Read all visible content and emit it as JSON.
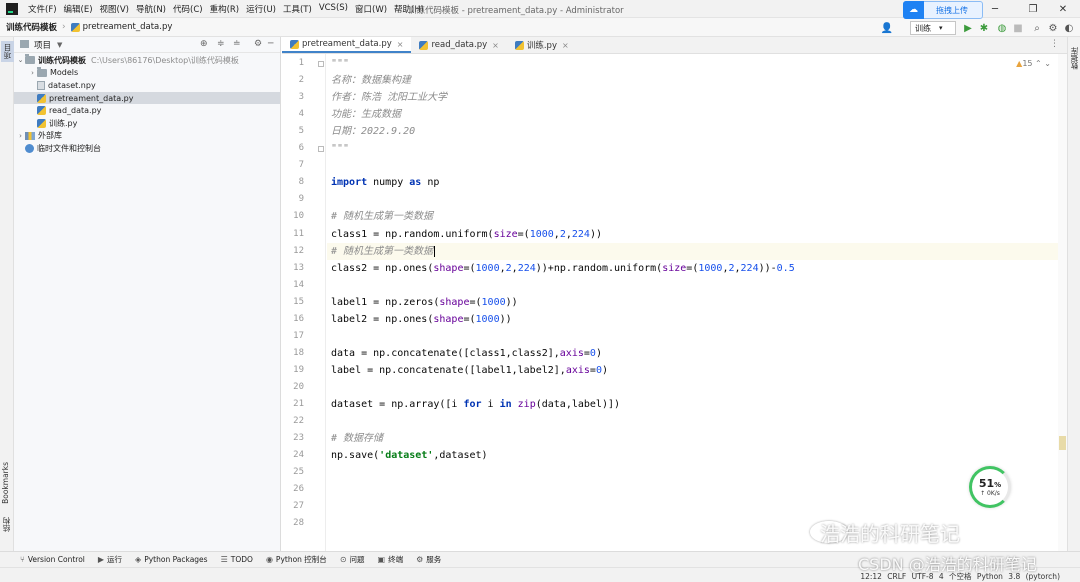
{
  "window": {
    "title": "训练代码模板 - pretreament_data.py - Administrator",
    "controls": {
      "minimize": "─",
      "restore": "❐",
      "close": "✕"
    }
  },
  "menu": [
    "文件(F)",
    "编辑(E)",
    "视图(V)",
    "导航(N)",
    "代码(C)",
    "重构(R)",
    "运行(U)",
    "工具(T)",
    "VCS(S)",
    "窗口(W)",
    "帮助(H)"
  ],
  "nav": {
    "project": "训练代码模板",
    "separator": "›",
    "file": "pretreament_data.py",
    "upload_button": "拖拽上传",
    "run_config": "训练"
  },
  "left_strip": {
    "project_tab": "项目",
    "bookmarks_tab": "Bookmarks",
    "structure_tab": "结构"
  },
  "right_strip": {
    "db_tab": "数据库"
  },
  "project_panel": {
    "title": "项目",
    "tree": [
      {
        "label": "训练代码模板",
        "path": "C:\\Users\\86176\\Desktop\\训练代码模板",
        "type": "folder",
        "level": 0,
        "expanded": true
      },
      {
        "label": "Models",
        "type": "folder",
        "level": 1,
        "expanded": false
      },
      {
        "label": "dataset.npy",
        "type": "file",
        "level": 1
      },
      {
        "label": "pretreament_data.py",
        "type": "py",
        "level": 1,
        "selected": true
      },
      {
        "label": "read_data.py",
        "type": "py",
        "level": 1
      },
      {
        "label": "训练.py",
        "type": "py",
        "level": 1
      },
      {
        "label": "外部库",
        "type": "lib",
        "level": 0,
        "expanded": false
      },
      {
        "label": "临时文件和控制台",
        "type": "scratch",
        "level": 0
      }
    ]
  },
  "editor": {
    "tabs": [
      {
        "label": "pretreament_data.py",
        "active": true
      },
      {
        "label": "read_data.py",
        "active": false
      },
      {
        "label": "训练.py",
        "active": false
      }
    ],
    "warnings": "15",
    "current_line": 12,
    "lines": [
      {
        "n": "1",
        "tokens": [
          [
            "doc",
            "\"\"\""
          ]
        ]
      },
      {
        "n": "2",
        "tokens": [
          [
            "doc",
            "名称：数据集构建"
          ]
        ]
      },
      {
        "n": "3",
        "tokens": [
          [
            "doc",
            "作者：陈浩 沈阳工业大学"
          ]
        ]
      },
      {
        "n": "4",
        "tokens": [
          [
            "doc",
            "功能：生成数据"
          ]
        ]
      },
      {
        "n": "5",
        "tokens": [
          [
            "doc",
            "日期：2022.9.20"
          ]
        ]
      },
      {
        "n": "6",
        "tokens": [
          [
            "doc",
            "\"\"\""
          ]
        ]
      },
      {
        "n": "7",
        "tokens": []
      },
      {
        "n": "8",
        "tokens": [
          [
            "kw",
            "import"
          ],
          [
            "",
            " numpy "
          ],
          [
            "kw",
            "as"
          ],
          [
            "",
            " np"
          ]
        ]
      },
      {
        "n": "9",
        "tokens": []
      },
      {
        "n": "10",
        "tokens": [
          [
            "cmt",
            "# 随机生成第一类数据"
          ]
        ]
      },
      {
        "n": "11",
        "tokens": [
          [
            "",
            "class1 = np.random.uniform("
          ],
          [
            "kwarg",
            "size"
          ],
          [
            "",
            "=("
          ],
          [
            "num",
            "1000"
          ],
          [
            "",
            ","
          ],
          [
            "num",
            "2"
          ],
          [
            "",
            ","
          ],
          [
            "num",
            "224"
          ],
          [
            "",
            "))"
          ]
        ]
      },
      {
        "n": "12",
        "tokens": [
          [
            "cmt",
            "# 随机生成第一类数据"
          ]
        ]
      },
      {
        "n": "13",
        "tokens": [
          [
            "",
            "class2 = np.ones("
          ],
          [
            "kwarg",
            "shape"
          ],
          [
            "",
            "=("
          ],
          [
            "num",
            "1000"
          ],
          [
            "",
            ","
          ],
          [
            "num",
            "2"
          ],
          [
            "",
            ","
          ],
          [
            "num",
            "224"
          ],
          [
            "",
            "))+np.random.uniform("
          ],
          [
            "kwarg",
            "size"
          ],
          [
            "",
            "=("
          ],
          [
            "num",
            "1000"
          ],
          [
            "",
            ","
          ],
          [
            "num",
            "2"
          ],
          [
            "",
            ","
          ],
          [
            "num",
            "224"
          ],
          [
            "",
            "))-"
          ],
          [
            "num",
            "0.5"
          ]
        ]
      },
      {
        "n": "14",
        "tokens": []
      },
      {
        "n": "15",
        "tokens": [
          [
            "",
            "label1 = np.zeros("
          ],
          [
            "kwarg",
            "shape"
          ],
          [
            "",
            "=("
          ],
          [
            "num",
            "1000"
          ],
          [
            "",
            "))"
          ]
        ]
      },
      {
        "n": "16",
        "tokens": [
          [
            "",
            "label2 = np.ones("
          ],
          [
            "kwarg",
            "shape"
          ],
          [
            "",
            "=("
          ],
          [
            "num",
            "1000"
          ],
          [
            "",
            "))"
          ]
        ]
      },
      {
        "n": "17",
        "tokens": []
      },
      {
        "n": "18",
        "tokens": [
          [
            "",
            "data = np.concatenate([class1,class2],"
          ],
          [
            "kwarg",
            "axis"
          ],
          [
            "",
            "="
          ],
          [
            "num",
            "0"
          ],
          [
            "",
            ")"
          ]
        ]
      },
      {
        "n": "19",
        "tokens": [
          [
            "",
            "label = np.concatenate([label1,label2],"
          ],
          [
            "kwarg",
            "axis"
          ],
          [
            "",
            "="
          ],
          [
            "num",
            "0"
          ],
          [
            "",
            ")"
          ]
        ]
      },
      {
        "n": "20",
        "tokens": []
      },
      {
        "n": "21",
        "tokens": [
          [
            "",
            "dataset = np.array([i "
          ],
          [
            "kw",
            "for"
          ],
          [
            "",
            " i "
          ],
          [
            "kw",
            "in"
          ],
          [
            "",
            " "
          ],
          [
            "kwarg",
            "zip"
          ],
          [
            "",
            "(data,label)])"
          ]
        ]
      },
      {
        "n": "22",
        "tokens": []
      },
      {
        "n": "23",
        "tokens": [
          [
            "cmt",
            "# 数据存储"
          ]
        ]
      },
      {
        "n": "24",
        "tokens": [
          [
            "",
            "np.save("
          ],
          [
            "str",
            "'dataset'"
          ],
          [
            "",
            ",dataset)"
          ]
        ]
      },
      {
        "n": "25",
        "tokens": []
      },
      {
        "n": "26",
        "tokens": []
      },
      {
        "n": "27",
        "tokens": []
      },
      {
        "n": "28",
        "tokens": []
      }
    ]
  },
  "cpu_widget": {
    "percent": "51",
    "unit": "%",
    "rate": "↑ 0K/s",
    "progress": 0.51
  },
  "bottom_tools": [
    {
      "icon": "⑂",
      "label": "Version Control"
    },
    {
      "icon": "▶",
      "label": "运行"
    },
    {
      "icon": "◈",
      "label": "Python Packages"
    },
    {
      "icon": "☰",
      "label": "TODO"
    },
    {
      "icon": "◉",
      "label": "Python 控制台"
    },
    {
      "icon": "⊙",
      "label": "问题"
    },
    {
      "icon": "▣",
      "label": "终端"
    },
    {
      "icon": "⚙",
      "label": "服务"
    }
  ],
  "status": {
    "text": "12:12  CRLF  UTF-8  4 个空格  Python 3.8 (pytorch)"
  },
  "watermarks": {
    "wechat": "浩浩的科研笔记",
    "csdn": "CSDN @浩浩的科研笔记"
  },
  "colors": {
    "accent": "#4083c9",
    "current_line": "#fcfaed",
    "keyword": "#0033b3",
    "number": "#1750eb",
    "string": "#067d17",
    "comment": "#8c8c8c",
    "cpu_ring": "#41c463"
  }
}
